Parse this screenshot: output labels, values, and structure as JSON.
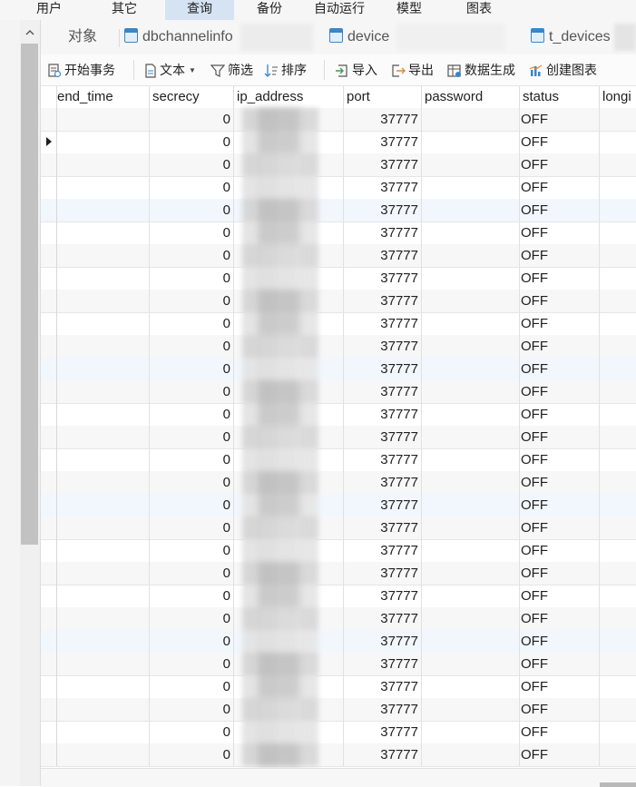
{
  "menu": {
    "items": [
      "用户",
      "其它",
      "查询",
      "备份",
      "自动运行",
      "模型",
      "图表"
    ],
    "active": "查询"
  },
  "tabs": {
    "objects_label": "对象",
    "items": [
      "dbchannelinfo",
      "device",
      "t_devices"
    ]
  },
  "toolbar": {
    "begin_transaction": "开始事务",
    "text": "文本",
    "filter": "筛选",
    "sort": "排序",
    "import": "导入",
    "export": "导出",
    "data_generation": "数据生成",
    "create_chart": "创建图表"
  },
  "grid": {
    "columns": [
      "end_time",
      "secrecy",
      "ip_address",
      "port",
      "password",
      "status",
      "longi"
    ],
    "rows": [
      {
        "secrecy": "0",
        "port": "37777",
        "status": "OFF"
      },
      {
        "secrecy": "0",
        "port": "37777",
        "status": "OFF"
      },
      {
        "secrecy": "0",
        "port": "37777",
        "status": "OFF"
      },
      {
        "secrecy": "0",
        "port": "37777",
        "status": "OFF"
      },
      {
        "secrecy": "0",
        "port": "37777",
        "status": "OFF"
      },
      {
        "secrecy": "0",
        "port": "37777",
        "status": "OFF"
      },
      {
        "secrecy": "0",
        "port": "37777",
        "status": "OFF"
      },
      {
        "secrecy": "0",
        "port": "37777",
        "status": "OFF"
      },
      {
        "secrecy": "0",
        "port": "37777",
        "status": "OFF"
      },
      {
        "secrecy": "0",
        "port": "37777",
        "status": "OFF"
      },
      {
        "secrecy": "0",
        "port": "37777",
        "status": "OFF"
      },
      {
        "secrecy": "0",
        "port": "37777",
        "status": "OFF"
      },
      {
        "secrecy": "0",
        "port": "37777",
        "status": "OFF"
      },
      {
        "secrecy": "0",
        "port": "37777",
        "status": "OFF"
      },
      {
        "secrecy": "0",
        "port": "37777",
        "status": "OFF"
      },
      {
        "secrecy": "0",
        "port": "37777",
        "status": "OFF"
      },
      {
        "secrecy": "0",
        "port": "37777",
        "status": "OFF"
      },
      {
        "secrecy": "0",
        "port": "37777",
        "status": "OFF"
      },
      {
        "secrecy": "0",
        "port": "37777",
        "status": "OFF"
      },
      {
        "secrecy": "0",
        "port": "37777",
        "status": "OFF"
      },
      {
        "secrecy": "0",
        "port": "37777",
        "status": "OFF"
      },
      {
        "secrecy": "0",
        "port": "37777",
        "status": "OFF"
      },
      {
        "secrecy": "0",
        "port": "37777",
        "status": "OFF"
      },
      {
        "secrecy": "0",
        "port": "37777",
        "status": "OFF"
      },
      {
        "secrecy": "0",
        "port": "37777",
        "status": "OFF"
      },
      {
        "secrecy": "0",
        "port": "37777",
        "status": "OFF"
      },
      {
        "secrecy": "0",
        "port": "37777",
        "status": "OFF"
      },
      {
        "secrecy": "0",
        "port": "37777",
        "status": "OFF"
      },
      {
        "secrecy": "0",
        "port": "37777",
        "status": "OFF"
      }
    ],
    "current_row_index": 1
  },
  "colors": {
    "menu_active_bg": "#d5e3f3",
    "tab_icon": "#3a86c8",
    "row_alt_bg": "#f7f7f7",
    "row_highlight_bg": "#f2f7fd"
  }
}
